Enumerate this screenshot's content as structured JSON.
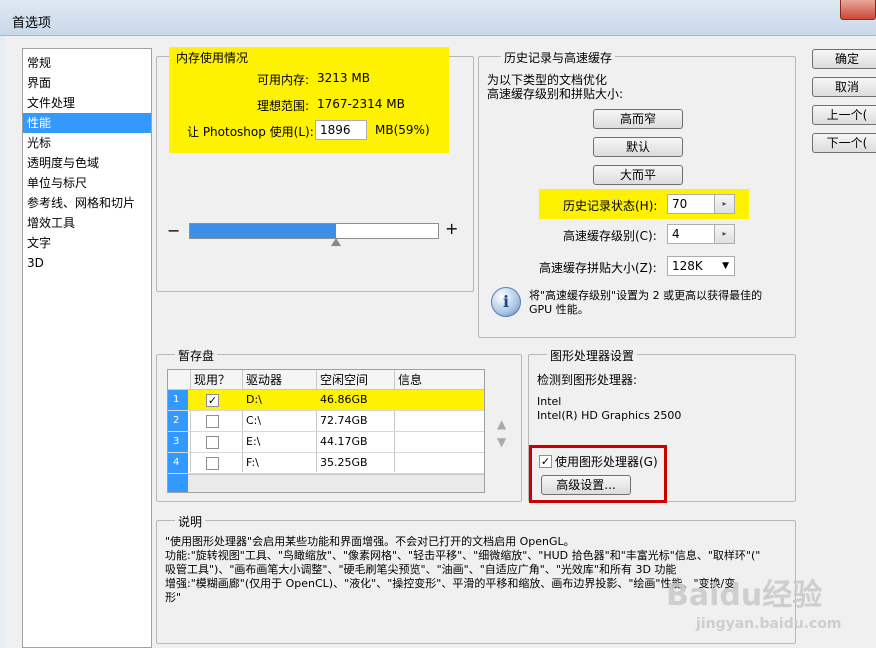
{
  "window": {
    "title": "首选项"
  },
  "nav": {
    "items": [
      "常规",
      "界面",
      "文件处理",
      "性能",
      "光标",
      "透明度与色域",
      "单位与标尺",
      "参考线、网格和切片",
      "增效工具",
      "文字",
      "3D"
    ],
    "selected_index": 3
  },
  "memory": {
    "group_title": "内存使用情况",
    "available_label": "可用内存:",
    "available_value": "3213 MB",
    "ideal_label": "理想范围:",
    "ideal_value": "1767-2314 MB",
    "let_label": "让 Photoshop 使用(L):",
    "let_value": "1896",
    "let_unit": "MB(59%)",
    "slider_minus": "−",
    "slider_plus": "+",
    "slider_fraction": 0.59
  },
  "history": {
    "group_title": "历史记录与高速缓存",
    "desc_line1": "为以下类型的文档优化",
    "desc_line2": "高速缓存级别和拼贴大小:",
    "btn_tall_thin": "高而窄",
    "btn_default": "默认",
    "btn_big_flat": "大而平",
    "states_label": "历史记录状态(H):",
    "states_value": "70",
    "cache_levels_label": "高速缓存级别(C):",
    "cache_levels_value": "4",
    "tile_size_label": "高速缓存拼贴大小(Z):",
    "tile_size_value": "128K",
    "info_line1": "将\"高速缓存级别\"设置为 2 或更高以获得最佳的",
    "info_line2": "GPU 性能。"
  },
  "scratch": {
    "group_title": "暂存盘",
    "headers": [
      "现用？",
      "驱动器",
      "空闲空间",
      "信息"
    ],
    "rows": [
      {
        "num": "1",
        "checked": true,
        "drive": "D:\\",
        "free": "46.86GB"
      },
      {
        "num": "2",
        "checked": false,
        "drive": "C:\\",
        "free": "72.74GB"
      },
      {
        "num": "3",
        "checked": false,
        "drive": "E:\\",
        "free": "44.17GB"
      },
      {
        "num": "4",
        "checked": false,
        "drive": "F:\\",
        "free": "35.25GB"
      }
    ],
    "check_mark": "✓"
  },
  "gpu": {
    "group_title": "图形处理器设置",
    "detected_label": "检测到图形处理器:",
    "vendor": "Intel",
    "model": "Intel(R) HD Graphics 2500",
    "use_gpu_label": "使用图形处理器(G)",
    "use_gpu_checked": true,
    "advanced_button": "高级设置..."
  },
  "description": {
    "group_title": "说明",
    "line1": "\"使用图形处理器\"会启用某些功能和界面增强。不会对已打开的文档启用 OpenGL。",
    "line2": "功能:\"旋转视图\"工具、\"鸟瞰缩放\"、\"像素网格\"、\"轻击平移\"、\"细微缩放\"、\"HUD 拾色器\"和\"丰富光标\"信息、\"取样环\"(\"",
    "line3": "吸管工具\")、\"画布画笔大小调整\"、\"硬毛刷笔尖预览\"、\"油画\"、\"自适应广角\"、\"光效库\"和所有 3D 功能",
    "line4": "增强:\"模糊画廊\"(仅用于 OpenCL)、\"液化\"、\"操控变形\"、平滑的平移和缩放、画布边界投影、\"绘画\"性能、\"变换/变",
    "line5": "形\""
  },
  "buttons": {
    "ok": "确定",
    "cancel": "取消",
    "prev": "上一个(",
    "next": "下一个("
  },
  "watermark": {
    "brand": "Baidu经验",
    "site": "jingyan.baidu.com"
  },
  "colors": {
    "highlight": "#fff200",
    "selection": "#3399ff",
    "red_outline": "#cc0000"
  }
}
